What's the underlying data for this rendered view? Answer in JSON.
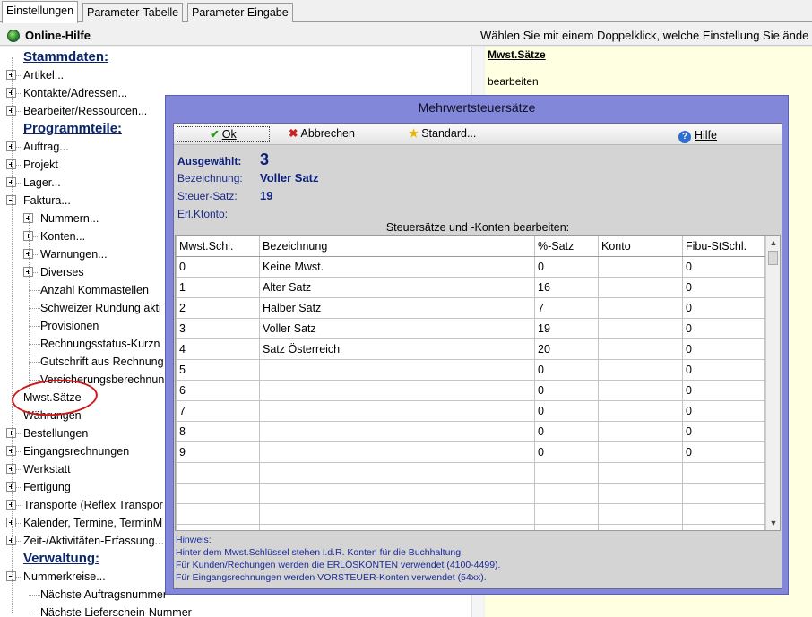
{
  "tabs": [
    "Einstellungen",
    "Parameter-Tabelle",
    "Parameter Eingabe"
  ],
  "header": {
    "title": "Online-Hilfe",
    "hint": "Wählen Sie mit einem Doppelklick, welche Einstellung Sie ände"
  },
  "tree": [
    {
      "label": "Stammdaten:",
      "section": true
    },
    {
      "label": "Artikel...",
      "expander": "plus"
    },
    {
      "label": "Kontakte/Adressen...",
      "expander": "plus"
    },
    {
      "label": "Bearbeiter/Ressourcen...",
      "expander": "plus"
    },
    {
      "label": "Programmteile:",
      "section": true
    },
    {
      "label": "Auftrag...",
      "expander": "plus"
    },
    {
      "label": "Projekt",
      "expander": "plus"
    },
    {
      "label": "Lager...",
      "expander": "plus"
    },
    {
      "label": "Faktura...",
      "expander": "minus"
    },
    {
      "label": "Nummern...",
      "expander": "plus",
      "child": true
    },
    {
      "label": "Konten...",
      "expander": "plus",
      "child": true
    },
    {
      "label": "Warnungen...",
      "expander": "plus",
      "child": true
    },
    {
      "label": "Diverses",
      "expander": "plus",
      "child": true
    },
    {
      "label": "Anzahl Kommastellen",
      "child": true
    },
    {
      "label": "Schweizer Rundung akti",
      "child": true
    },
    {
      "label": "Provisionen",
      "child": true
    },
    {
      "label": "Rechnungsstatus-Kurzn",
      "child": true
    },
    {
      "label": "Gutschrift aus Rechnung",
      "child": true
    },
    {
      "label": "Versicherungsberechnun",
      "child": true
    },
    {
      "label": "Mwst.Sätze"
    },
    {
      "label": "Währungen"
    },
    {
      "label": "Bestellungen",
      "expander": "plus"
    },
    {
      "label": "Eingangsrechnungen",
      "expander": "plus"
    },
    {
      "label": "Werkstatt",
      "expander": "plus"
    },
    {
      "label": "Fertigung",
      "expander": "plus"
    },
    {
      "label": "Transporte (Reflex Transpor",
      "expander": "plus"
    },
    {
      "label": "Kalender, Termine, TerminM",
      "expander": "plus"
    },
    {
      "label": "Zeit-/Aktivitäten-Erfassung...",
      "expander": "plus"
    },
    {
      "label": "Verwaltung:",
      "section": true
    },
    {
      "label": "Nummerkreise...",
      "expander": "minus"
    },
    {
      "label": "Nächste Auftragsnummer",
      "child": true
    },
    {
      "label": "Nächste Lieferschein-Nummer",
      "child": true
    }
  ],
  "right_panel": {
    "title": "Mwst.Sätze",
    "text": "bearbeiten"
  },
  "dialog": {
    "title": "Mehrwertsteuersätze",
    "toolbar": {
      "ok": "Ok",
      "cancel": "Abbrechen",
      "standard": "Standard...",
      "help": "Hilfe"
    },
    "selected_label": "Ausgewählt:",
    "selected_value": "3",
    "fields": [
      {
        "label": "Bezeichnung:",
        "value": "Voller Satz"
      },
      {
        "label": "Steuer-Satz:",
        "value": "19"
      },
      {
        "label": "Erl.Ktonto:",
        "value": ""
      }
    ],
    "grid_caption": "Steuersätze und -Konten bearbeiten:",
    "columns": [
      "Mwst.Schl.",
      "Bezeichnung",
      "%-Satz",
      "Konto",
      "Fibu-StSchl."
    ],
    "rows": [
      [
        "0",
        "Keine Mwst.",
        "0",
        "",
        "0"
      ],
      [
        "1",
        "Alter Satz",
        "16",
        "",
        "0"
      ],
      [
        "2",
        "Halber Satz",
        "7",
        "",
        "0"
      ],
      [
        "3",
        "Voller Satz",
        "19",
        "",
        "0"
      ],
      [
        "4",
        "Satz Österreich",
        "20",
        "",
        "0"
      ],
      [
        "5",
        "",
        "0",
        "",
        "0"
      ],
      [
        "6",
        "",
        "0",
        "",
        "0"
      ],
      [
        "7",
        "",
        "0",
        "",
        "0"
      ],
      [
        "8",
        "",
        "0",
        "",
        "0"
      ],
      [
        "9",
        "",
        "0",
        "",
        "0"
      ],
      [
        "",
        "",
        "",
        "",
        ""
      ],
      [
        "",
        "",
        "",
        "",
        ""
      ],
      [
        "",
        "",
        "",
        "",
        ""
      ],
      [
        "",
        "",
        "",
        "",
        ""
      ]
    ],
    "notes": [
      "Hinweis:",
      "Hinter dem Mwst.Schlüssel stehen i.d.R. Konten für die Buchhaltung.",
      "Für Kunden/Rechungen werden die ERLÖSKONTEN verwendet (4100-4499).",
      "Für Eingangsrechnungen werden VORSTEUER-Konten verwendet (54xx)."
    ]
  },
  "colors": {
    "dialog_frame": "#8287d9",
    "help_panel": "#ffffe1",
    "annotation": "#d01818",
    "label_blue": "#0a1e7a"
  }
}
